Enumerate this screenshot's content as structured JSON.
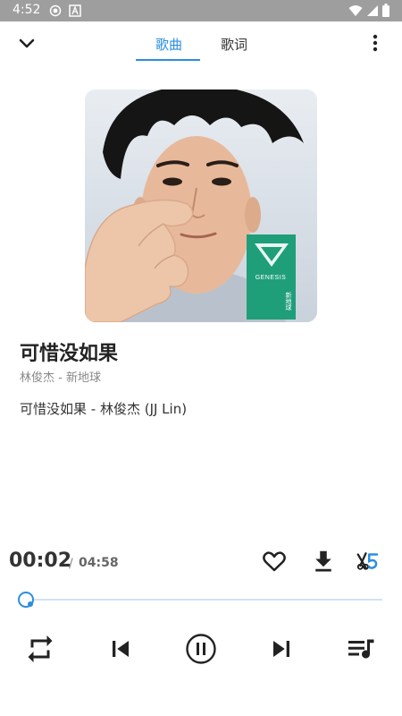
{
  "status_bar": {
    "time": "4:52",
    "icons": [
      "record-icon",
      "a-icon",
      "wifi-icon",
      "signal-icon",
      "battery-icon"
    ]
  },
  "header": {
    "back_icon": "chevron-down-icon",
    "tabs": [
      {
        "label": "歌曲",
        "active": true
      },
      {
        "label": "歌词",
        "active": false
      }
    ],
    "more_icon": "more-vertical-icon"
  },
  "album": {
    "sleeve_text_top": "GENESIS",
    "sleeve_text_side": "新地球"
  },
  "song": {
    "title": "可惜没如果",
    "artist_album": "林俊杰 - 新地球",
    "lyric_line": "可惜没如果 - 林俊杰 (JJ Lin)"
  },
  "playback": {
    "current_time": "00:02",
    "separator": "/",
    "total_time": "04:58",
    "progress": 0.007
  },
  "actions": [
    "heart-icon",
    "download-icon",
    "quality-icon"
  ],
  "controls": [
    "repeat-icon",
    "previous-icon",
    "pause-icon",
    "next-icon",
    "queue-icon"
  ],
  "colors": {
    "accent": "#2b8ee0",
    "status_bar": "#9e9e9e",
    "cover_sleeve": "#1f9e7a"
  }
}
